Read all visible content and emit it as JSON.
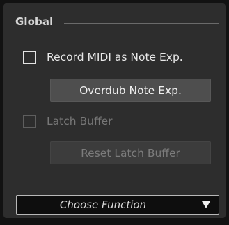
{
  "section": {
    "title": "Global"
  },
  "record_midi": {
    "label": "Record MIDI as Note Exp.",
    "checked": false,
    "enabled": true
  },
  "overdub_button": {
    "label": "Overdub Note Exp.",
    "enabled": true
  },
  "latch_buffer": {
    "label": "Latch Buffer",
    "checked": false,
    "enabled": false
  },
  "reset_latch_button": {
    "label": "Reset Latch Buffer",
    "enabled": false
  },
  "function_select": {
    "value": "Choose Function",
    "arrow_icon": "triangle-down-icon"
  },
  "colors": {
    "panel_bg": "#2d2d2d",
    "text": "#e8e8e8",
    "disabled_text": "#777777",
    "button_bg": "#4e4e4e",
    "select_bg": "#0e0e0e"
  }
}
